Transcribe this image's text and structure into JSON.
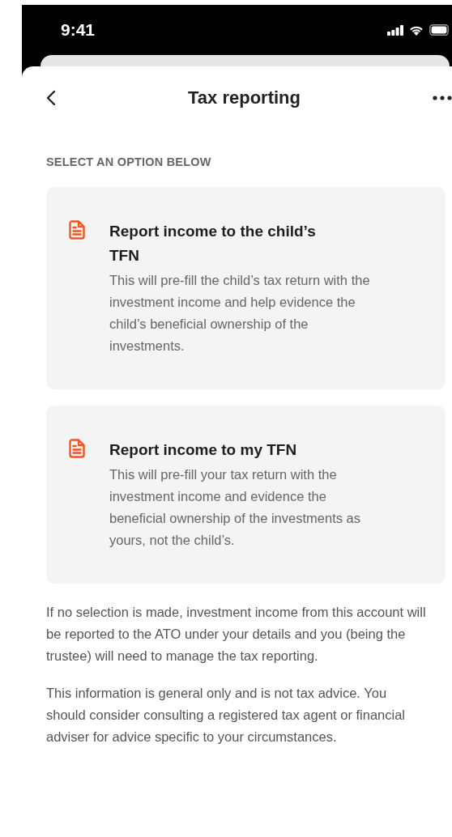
{
  "status_bar": {
    "time": "9:41"
  },
  "header": {
    "title": "Tax reporting"
  },
  "section_label": "SELECT AN OPTION BELOW",
  "options": [
    {
      "title": "Report income to the child’s TFN",
      "description": "This will pre-fill the child’s tax return with the investment income and help evidence the child’s beneficial ownership of the investments."
    },
    {
      "title": "Report income to my TFN",
      "description": "This will pre-fill your tax return with the investment income and evidence the beneficial ownership of the investments as yours, not the child’s."
    }
  ],
  "notes": [
    "If no selection is made, investment income from this account will be reported to the ATO under your details and you (being the trustee) will need to manage the tax reporting.",
    "This information is general only and is not tax advice. You should consider consulting a registered tax agent or financial adviser for advice specific to your circumstances."
  ]
}
